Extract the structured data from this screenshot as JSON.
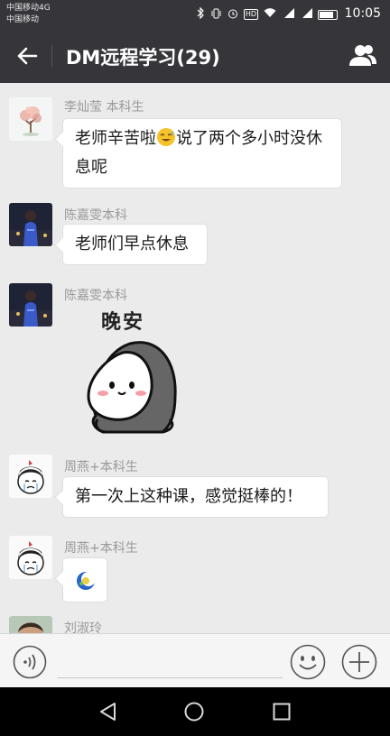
{
  "status_bar": {
    "carrier_1": "中国移动4G",
    "carrier_2": "中国移动",
    "signal_1": "⁴⁶",
    "signal_2": "²⁶",
    "hd": "HD",
    "time": "10:05"
  },
  "header": {
    "title": "DM远程学习(29)",
    "back_icon": "arrow-left-icon",
    "members_icon": "group-members-icon"
  },
  "messages": [
    {
      "sender": "李灿莹 本科生",
      "text_before_emoji": "老师辛苦啦",
      "emoji": "sweat-smile-emoji",
      "text_after_emoji": "说了两个多小时没休息呢",
      "avatar": "blossom-tree-avatar"
    },
    {
      "sender": "陈嘉雯本科",
      "text": "老师们早点休息",
      "avatar": "night-city-avatar"
    },
    {
      "sender": "陈嘉雯本科",
      "sticker_text": "晚安",
      "sticker": "blanket-ghost-goodnight-sticker",
      "avatar": "night-city-avatar"
    },
    {
      "sender": "周燕+本科生",
      "text": "第一次上这种课，感觉挺棒的！",
      "avatar": "cartoon-girl-avatar"
    },
    {
      "sender": "周燕+本科生",
      "emoji": "blue-moon-emoji",
      "avatar": "cartoon-girl-avatar"
    },
    {
      "sender": "刘淑玲",
      "avatar": "photo-avatar"
    }
  ],
  "input_bar": {
    "voice_icon": "voice-icon",
    "emoji_icon": "smiley-icon",
    "plus_icon": "plus-icon"
  },
  "nav_bar": {
    "back_icon": "triangle-back-icon",
    "home_icon": "circle-home-icon",
    "recent_icon": "square-recents-icon"
  }
}
